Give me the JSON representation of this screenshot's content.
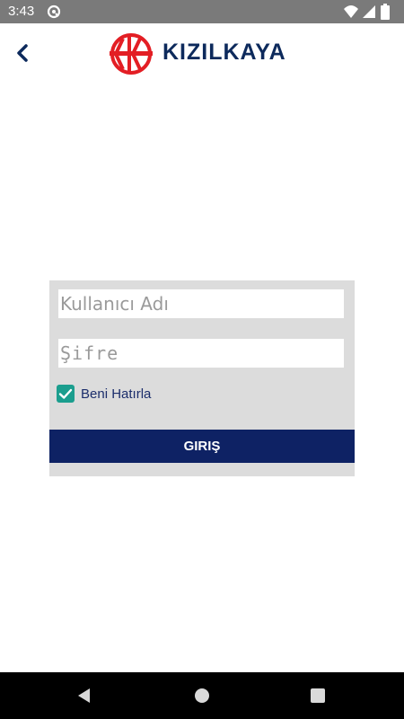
{
  "status_bar": {
    "time": "3:43",
    "icons": [
      "app-notification-icon",
      "wifi-icon",
      "cellular-signal-icon",
      "battery-icon"
    ]
  },
  "header": {
    "back_icon": "chevron-left-icon",
    "logo_text": "KIZILKAYA",
    "colors": {
      "logo_red": "#e31e24",
      "logo_navy": "#0d2a5c"
    }
  },
  "login_form": {
    "username_placeholder": "Kullanıcı Adı",
    "username_value": "",
    "password_placeholder": "Şifre",
    "password_value": "",
    "remember_me_label": "Beni Hatırla",
    "remember_me_checked": true,
    "login_button_label": "GIRIŞ",
    "colors": {
      "card_bg": "#dcdcdc",
      "button_bg": "#0e2264",
      "checkbox": "#1b9e8e"
    }
  },
  "nav_bar": {
    "icons": [
      "nav-back-icon",
      "nav-home-icon",
      "nav-recents-icon"
    ]
  }
}
